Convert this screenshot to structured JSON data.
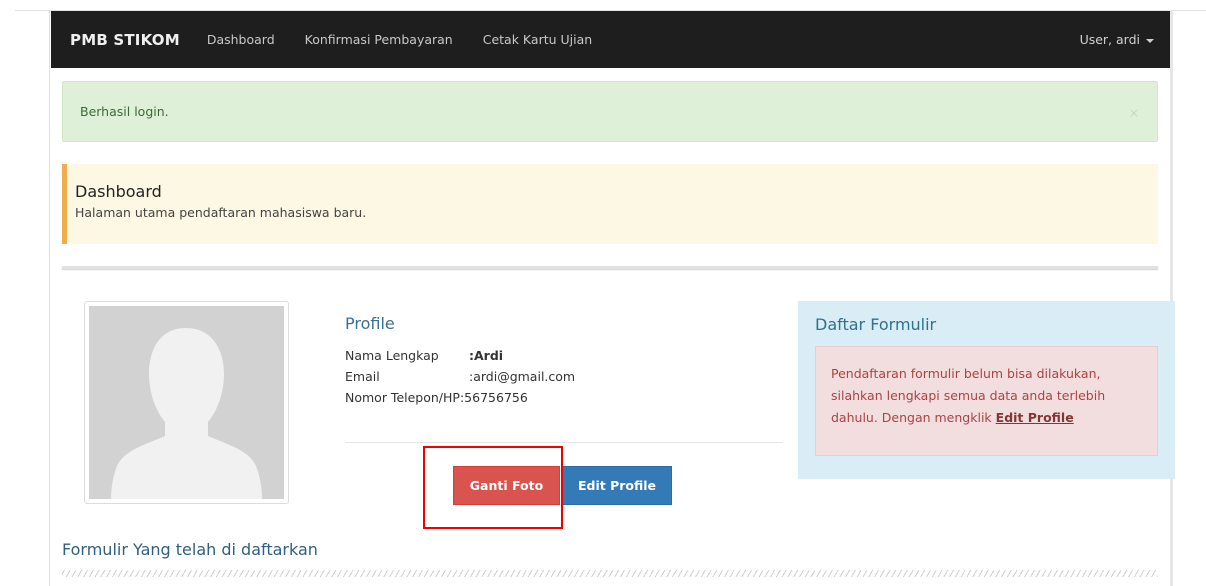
{
  "navbar": {
    "brand": "PMB STIKOM",
    "links": [
      "Dashboard",
      "Konfirmasi Pembayaran",
      "Cetak Kartu Ujian"
    ],
    "user": "User, ardi"
  },
  "alert": {
    "message": "Berhasil login.",
    "close": "×"
  },
  "callout": {
    "title": "Dashboard",
    "description": "Halaman utama pendaftaran mahasiswa baru."
  },
  "profile": {
    "heading": "Profile",
    "rows": [
      {
        "label": "Nama Lengkap",
        "value": ":Ardi"
      },
      {
        "label": "Email",
        "value": ":ardi@gmail.com"
      },
      {
        "label": "Nomor Telepon/HP",
        "value": ":56756756"
      }
    ],
    "change_photo": "Ganti Foto",
    "edit_profile": "Edit Profile"
  },
  "daftar": {
    "heading": "Daftar Formulir",
    "message": "Pendaftaran formulir belum bisa dilakukan, silahkan lengkapi semua data anda terlebih dahulu. Dengan mengklik",
    "link": "Edit Profile"
  },
  "section": {
    "title": "Formulir Yang telah di daftarkan"
  },
  "colors": {
    "navbar": "#1e1e1e",
    "success_bg": "#dff0d8",
    "warning_bg": "#fcf8e3",
    "warning_border": "#f0ad4e",
    "info_bg": "#d9edf7",
    "danger_bg": "#f2dede",
    "btn_danger": "#d9534f",
    "btn_primary": "#337ab7",
    "highlight": "#f00000"
  }
}
